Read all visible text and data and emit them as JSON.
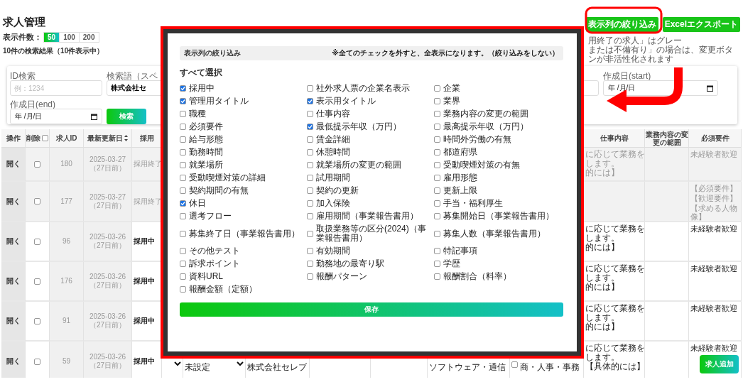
{
  "page": {
    "title": "求人管理",
    "header_buttons": [
      "表示列の絞り込み",
      "Excelエクスポート"
    ],
    "notes": [
      "用終了の求人」はグレー",
      "または不備有り」の場合は、変更ボタンが非活性化されます"
    ],
    "page_size": {
      "label": "表示件数：",
      "options": [
        {
          "label": "50",
          "selected": true
        },
        {
          "label": "100",
          "selected": false
        },
        {
          "label": "200",
          "selected": false
        }
      ]
    },
    "result_summary": "10件の検索結果（10件表示中）"
  },
  "filters": {
    "id_search": {
      "label": "ID検索",
      "placeholder": "例：1234"
    },
    "keyword": {
      "label": "検索語（スペ",
      "value": "株式会社セ"
    },
    "created_start": {
      "label": "作成日(start)",
      "value": "年 /月/日"
    },
    "created_end": {
      "label": "作成日(end)",
      "value": "年 /月/日"
    },
    "search_button": "検索"
  },
  "table": {
    "delete_all_checked": false,
    "left_columns": [
      "操作",
      "削除",
      "求人ID",
      "最新更新日",
      "採用"
    ],
    "right_columns": [
      "仕事内容",
      "業務内容の変更の範囲",
      "必須要件"
    ],
    "rows": [
      {
        "action": "開く",
        "checked": false,
        "id": "180",
        "updated": "2025-03-27",
        "ago": "（27日前）",
        "status": "採用終了",
        "ended": true,
        "job_content": [
          "に応じて業務を",
          "します。",
          "的には】"
        ],
        "requirements": [
          "未経験者歓迎"
        ]
      },
      {
        "action": "開く",
        "checked": false,
        "id": "177",
        "updated": "2025-03-27",
        "ago": "（27日前）",
        "status": "採用終了",
        "ended": true,
        "requirements": [
          "【必須要件】",
          "【歓迎要件】",
          "【求める人物像】"
        ]
      },
      {
        "action": "開く",
        "checked": false,
        "id": "96",
        "updated": "2025-03-26",
        "ago": "（27日前）",
        "status": "採用中",
        "ended": false,
        "job_content": [
          "に応じて業務を",
          "します。",
          "的には】"
        ],
        "requirements": [
          "未経験者歓迎"
        ]
      },
      {
        "action": "開く",
        "checked": false,
        "id": "176",
        "updated": "2025-03-26",
        "ago": "（27日前）",
        "status": "採用中",
        "ended": false,
        "job_content": [
          "に応じて業務を",
          "します。",
          "的には】"
        ],
        "requirements": [
          "未経験者歓迎"
        ]
      },
      {
        "action": "開く",
        "checked": false,
        "id": "91",
        "updated": "2025-03-26",
        "ago": "（27日前）",
        "status": "採用中",
        "ended": false,
        "job_content": [
          "に応じて業務を",
          "します。",
          "的には】"
        ],
        "requirements": [
          "未経験者歓迎"
        ]
      },
      {
        "action": "開く",
        "checked": false,
        "id": "59",
        "updated": "2025-03-26",
        "ago": "（27日前）",
        "status": "採用中",
        "ended": false,
        "middle": {
          "type_select": "未設定",
          "company": "株式会社セレブ",
          "industry": "ソフトウェア・通信",
          "occupation": "商・人事・事務",
          "occupation_checked": false
        },
        "job_content": [
          "に応じて業務を",
          "します。",
          "【具体的には】"
        ],
        "requirements": [
          "未経験者歓迎"
        ]
      }
    ]
  },
  "modal": {
    "title": "表示列の絞り込み",
    "note": "※全てのチェックを外すと、全表示になります。（絞り込みをしない）",
    "select_all": "すべて選択",
    "save_button": "保存",
    "columns": [
      {
        "label": "採用中",
        "checked": true
      },
      {
        "label": "社外求人票の企業名表示",
        "checked": false
      },
      {
        "label": "企業",
        "checked": false
      },
      {
        "label": "管理用タイトル",
        "checked": true
      },
      {
        "label": "表示用タイトル",
        "checked": true
      },
      {
        "label": "業界",
        "checked": false
      },
      {
        "label": "職種",
        "checked": false
      },
      {
        "label": "仕事内容",
        "checked": false
      },
      {
        "label": "業務内容の変更の範囲",
        "checked": false
      },
      {
        "label": "必須要件",
        "checked": false
      },
      {
        "label": "最低提示年収（万円）",
        "checked": true
      },
      {
        "label": "最高提示年収（万円）",
        "checked": false
      },
      {
        "label": "給与形態",
        "checked": false
      },
      {
        "label": "賃金詳細",
        "checked": false
      },
      {
        "label": "時間外労働の有無",
        "checked": false
      },
      {
        "label": "勤務時間",
        "checked": false
      },
      {
        "label": "休憩時間",
        "checked": false
      },
      {
        "label": "都道府県",
        "checked": false
      },
      {
        "label": "就業場所",
        "checked": false
      },
      {
        "label": "就業場所の変更の範囲",
        "checked": false
      },
      {
        "label": "受動喫煙対策の有無",
        "checked": false
      },
      {
        "label": "受動喫煙対策の詳細",
        "checked": false
      },
      {
        "label": "試用期間",
        "checked": false
      },
      {
        "label": "雇用形態",
        "checked": false
      },
      {
        "label": "契約期間の有無",
        "checked": false
      },
      {
        "label": "契約の更新",
        "checked": false
      },
      {
        "label": "更新上限",
        "checked": false
      },
      {
        "label": "休日",
        "checked": true
      },
      {
        "label": "加入保険",
        "checked": false
      },
      {
        "label": "手当・福利厚生",
        "checked": false
      },
      {
        "label": "選考フロー",
        "checked": false
      },
      {
        "label": "雇用期間（事業報告書用）",
        "checked": false
      },
      {
        "label": "募集開始日（事業報告書用）",
        "checked": false
      },
      {
        "label": "募集終了日（事業報告書用）",
        "checked": false
      },
      {
        "label": "取扱業務等の区分(2024)（事業報告書用）",
        "checked": false
      },
      {
        "label": "募集人数（事業報告書用）",
        "checked": false
      },
      {
        "label": "その他テスト",
        "checked": false
      },
      {
        "label": "有効期間",
        "checked": false
      },
      {
        "label": "特記事項",
        "checked": false
      },
      {
        "label": "訴求ポイント",
        "checked": false
      },
      {
        "label": "勤務地の最寄り駅",
        "checked": false
      },
      {
        "label": "学歴",
        "checked": false
      },
      {
        "label": "資料URL",
        "checked": false
      },
      {
        "label": "報酬パターン",
        "checked": false
      },
      {
        "label": "報酬割合（料率）",
        "checked": false
      },
      {
        "label": "報酬金額（定額）",
        "checked": false
      }
    ]
  },
  "add_button": "求人追加"
}
